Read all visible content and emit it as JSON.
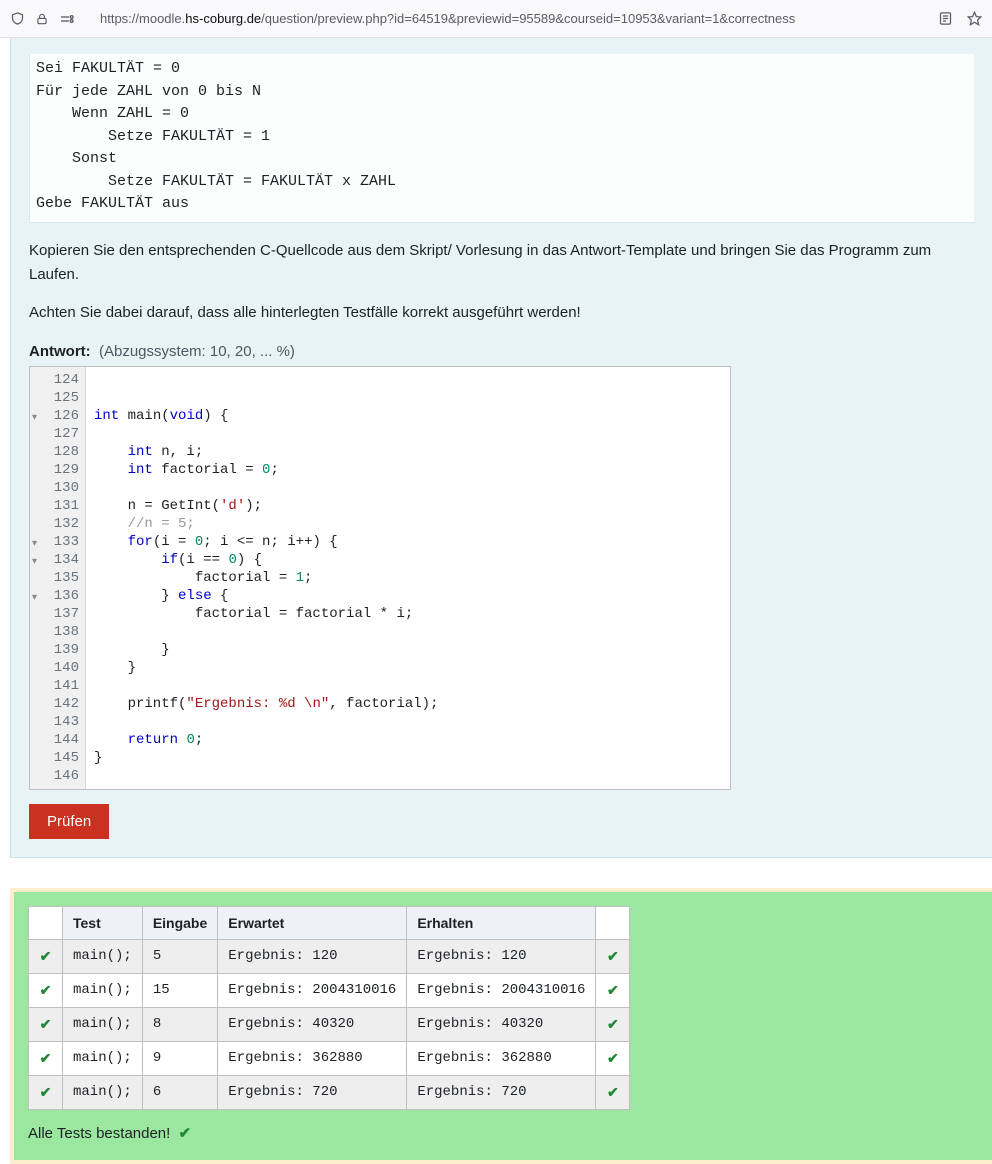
{
  "browser": {
    "url_pre": "https://moodle.",
    "url_domain": "hs-coburg.de",
    "url_post": "/question/preview.php?id=64519&previewid=95589&courseid=10953&variant=1&correctness"
  },
  "pseudocode": "Sei FAKULTÄT = 0\nFür jede ZAHL von 0 bis N\n    Wenn ZAHL = 0\n        Setze FAKULTÄT = 1\n    Sonst\n        Setze FAKULTÄT = FAKULTÄT x ZAHL\nGebe FAKULTÄT aus",
  "instructions": {
    "p1": "Kopieren Sie den entsprechenden C-Quellcode aus dem Skript/ Vorlesung in das Antwort-Template und bringen Sie das Programm zum Laufen.",
    "p2": "Achten Sie dabei darauf, dass alle hinterlegten Testfälle korrekt ausgeführt werden!"
  },
  "answer_label": "Antwort:",
  "answer_hint": "(Abzugssystem: 10, 20, ... %)",
  "editor": {
    "first_line": 124,
    "fold_lines": [
      126,
      133,
      134,
      136
    ],
    "lines": [
      "",
      "",
      "int main(void) {",
      "",
      "    int n, i;",
      "    int factorial = 0;",
      "",
      "    n = GetInt('d');",
      "    //n = 5;",
      "    for(i = 0; i <= n; i++) {",
      "        if(i == 0) {",
      "            factorial = 1;",
      "        } else {",
      "            factorial = factorial * i;",
      "",
      "        }",
      "    }",
      "",
      "    printf(\"Ergebnis: %d \\n\", factorial);",
      "",
      "    return 0;",
      "}",
      ""
    ]
  },
  "check_button": "Prüfen",
  "results": {
    "headers": [
      "",
      "Test",
      "Eingabe",
      "Erwartet",
      "Erhalten",
      ""
    ],
    "rows": [
      {
        "test": "main();",
        "input": "5",
        "expected": "Ergebnis: 120",
        "got": "Ergebnis: 120"
      },
      {
        "test": "main();",
        "input": "15",
        "expected": "Ergebnis: 2004310016",
        "got": "Ergebnis: 2004310016"
      },
      {
        "test": "main();",
        "input": "8",
        "expected": "Ergebnis: 40320",
        "got": "Ergebnis: 40320"
      },
      {
        "test": "main();",
        "input": "9",
        "expected": "Ergebnis: 362880",
        "got": "Ergebnis: 362880"
      },
      {
        "test": "main();",
        "input": "6",
        "expected": "Ergebnis: 720",
        "got": "Ergebnis: 720"
      }
    ],
    "pass_message": "Alle Tests bestanden!"
  }
}
